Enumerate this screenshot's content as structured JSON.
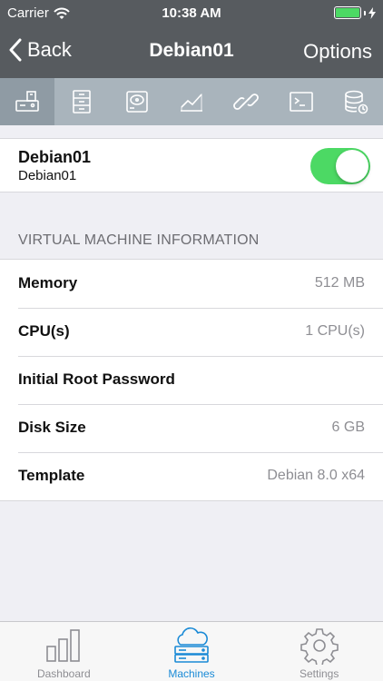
{
  "status_bar": {
    "carrier": "Carrier",
    "time": "10:38 AM",
    "battery_level": 1.0,
    "battery_color": "#4cd964"
  },
  "nav": {
    "back_label": "Back",
    "title": "Debian01",
    "options_label": "Options"
  },
  "toolbar": {
    "active_index": 0,
    "icons": [
      "machine-icon",
      "filing-cabinet-icon",
      "hard-disk-icon",
      "chart-icon",
      "link-icon",
      "terminal-icon",
      "database-refresh-icon"
    ]
  },
  "vm": {
    "name": "Debian01",
    "subtitle": "Debian01",
    "powered_on": true,
    "toggle_color": "#4cd964"
  },
  "section_header": "VIRTUAL MACHINE INFORMATION",
  "info": [
    {
      "label": "Memory",
      "value": "512 MB"
    },
    {
      "label": "CPU(s)",
      "value": "1 CPU(s)"
    },
    {
      "label": "Initial Root Password",
      "value": ""
    },
    {
      "label": "Disk Size",
      "value": "6 GB"
    },
    {
      "label": "Template",
      "value": "Debian 8.0 x64"
    }
  ],
  "tabs": [
    {
      "label": "Dashboard",
      "icon": "bar-chart-icon",
      "active": false
    },
    {
      "label": "Machines",
      "icon": "cloud-server-icon",
      "active": true
    },
    {
      "label": "Settings",
      "icon": "gear-icon",
      "active": false
    }
  ],
  "colors": {
    "nav_background": "#575b5f",
    "toolbar_background": "#a9b4bc",
    "accent": "#1a8ad6"
  }
}
